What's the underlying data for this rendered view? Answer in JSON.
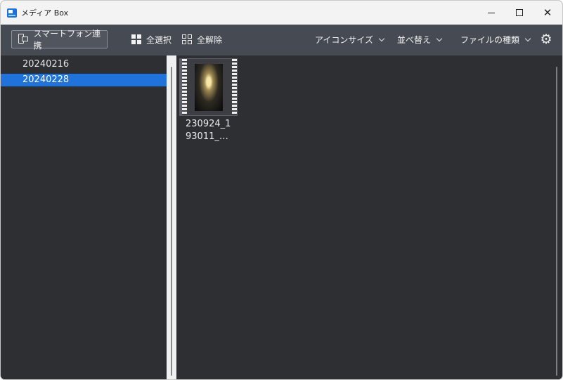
{
  "window": {
    "title": "メディア Box",
    "controls": {
      "minimize": "—",
      "maximize": "□",
      "close": "✕"
    }
  },
  "toolbar": {
    "phone_link_label": "スマートフォン連携",
    "select_all_label": "全選択",
    "deselect_all_label": "全解除",
    "icon_size_label": "アイコンサイズ",
    "sort_label": "並べ替え",
    "file_type_label": "ファイルの種類",
    "settings_glyph": "⚙"
  },
  "folders": [
    {
      "name": "20240216",
      "selected": false
    },
    {
      "name": "20240228",
      "selected": true
    }
  ],
  "files": [
    {
      "name_line1": "230924_1",
      "name_line2": "93011_…",
      "type": "video"
    }
  ],
  "colors": {
    "selection": "#1f73da",
    "toolbar": "#464a53",
    "pane_bg": "#2d2f33"
  }
}
